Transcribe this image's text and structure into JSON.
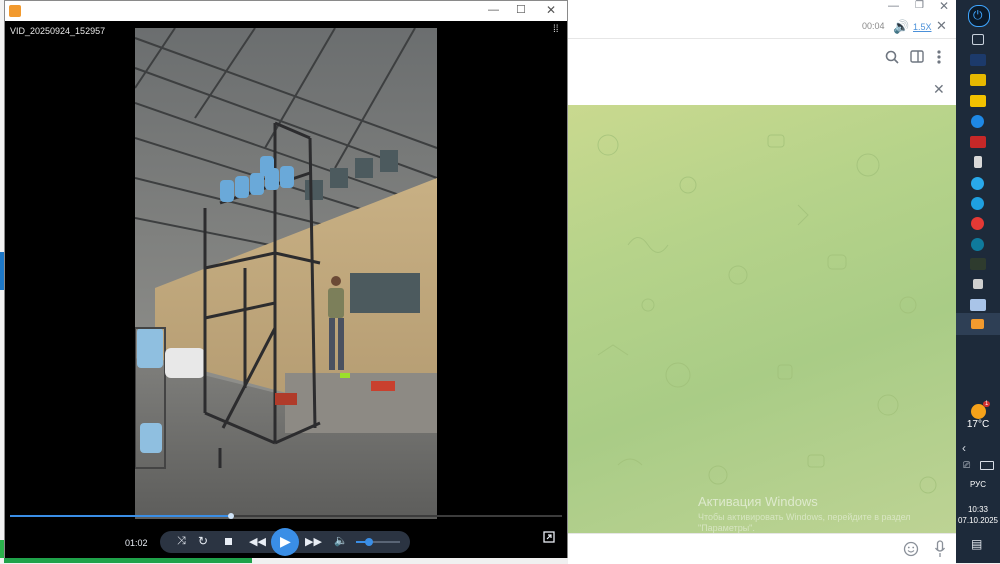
{
  "player": {
    "file_name": "VID_20250924_152957",
    "time_elapsed": "01:02",
    "progress": 0.4,
    "volume_level": 0.3
  },
  "telegram": {
    "audio_time": "00:04",
    "audio_speed": "1.5X",
    "watermark_title": "Активация Windows",
    "watermark_sub": "Чтобы активировать Windows, перейдите в раздел",
    "watermark_sub2": "\"Параметры\"."
  },
  "taskbar": {
    "temperature": "17°C",
    "weather_badge": "1",
    "language": "РУС",
    "time": "10:33",
    "date": "07.10.2025"
  },
  "colors": {
    "player_accent": "#3a8ee6",
    "chat_green": "#b6d38a",
    "taskbar_bg": "#1d2a3a"
  }
}
